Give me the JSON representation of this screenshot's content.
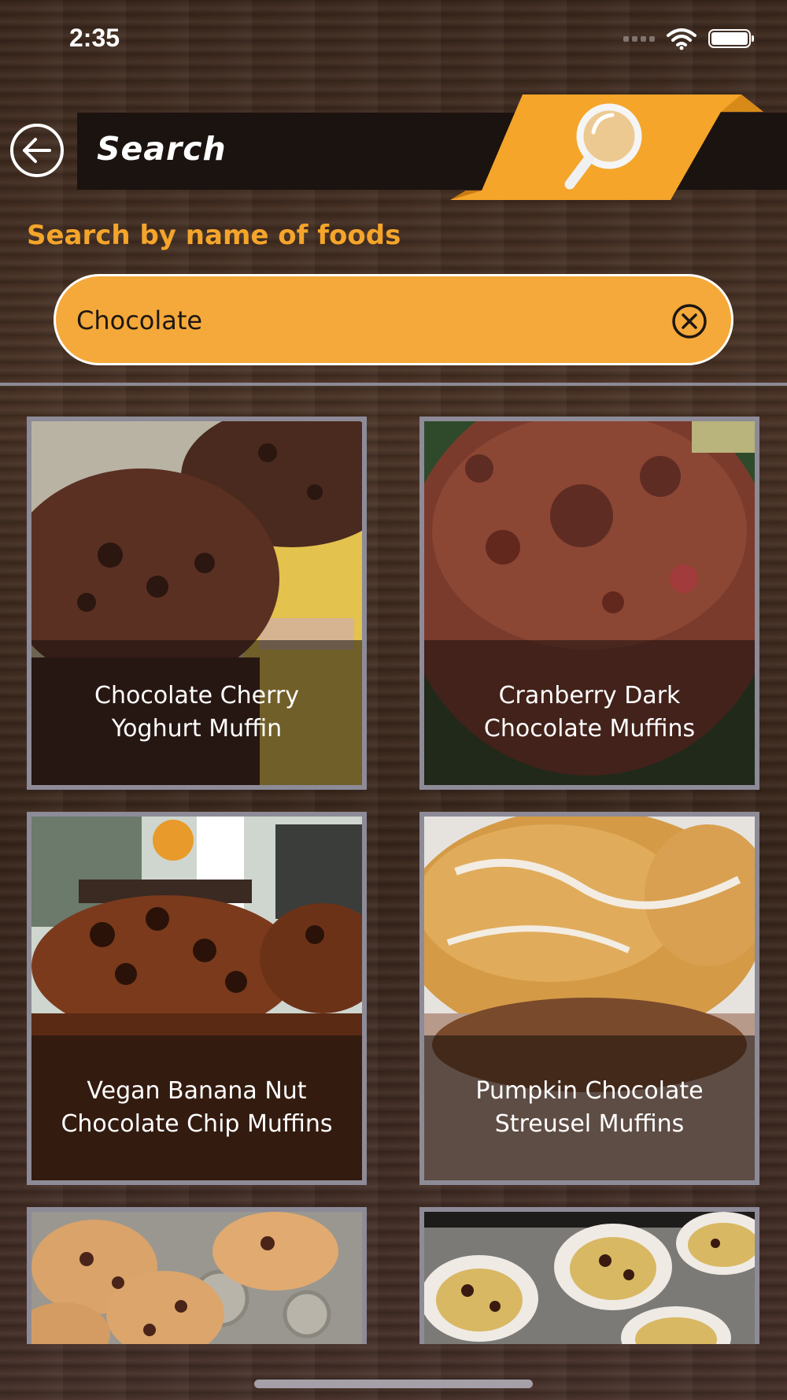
{
  "status_bar": {
    "time": "2:35",
    "wifi_icon": "wifi-icon",
    "battery_icon": "battery-icon"
  },
  "header": {
    "back_icon": "back-arrow-icon",
    "title": "Search",
    "banner_icon": "magnifier-icon",
    "accent_color": "#f4a52a"
  },
  "search": {
    "label": "Search by name of foods",
    "value": "Chocolate",
    "clear_icon": "clear-icon"
  },
  "results": [
    {
      "line1": "Chocolate Cherry",
      "line2": "Yoghurt Muffin"
    },
    {
      "line1": "Cranberry Dark",
      "line2": "Chocolate Muffins"
    },
    {
      "line1": "Vegan Banana Nut",
      "line2": "Chocolate Chip Muffins"
    },
    {
      "line1": "Pumpkin Chocolate",
      "line2": "Streusel Muffins"
    },
    {
      "line1": "",
      "line2": ""
    },
    {
      "line1": "",
      "line2": ""
    }
  ]
}
